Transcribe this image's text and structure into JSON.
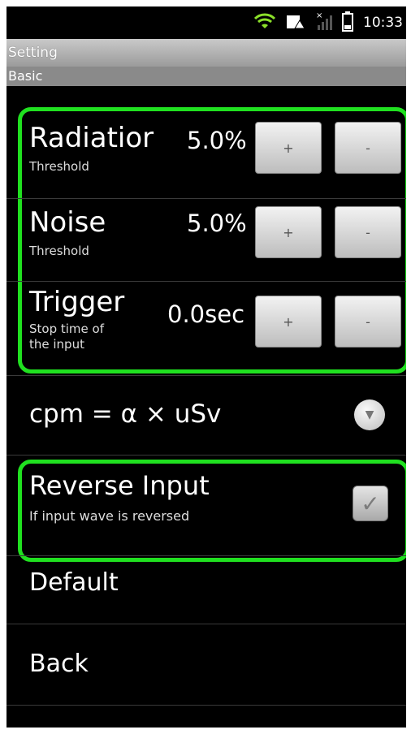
{
  "status": {
    "time": "10:33",
    "icons": [
      "wifi-icon",
      "sd-card-icon",
      "signal-icon",
      "battery-icon"
    ]
  },
  "titlebar": {
    "title": "Setting"
  },
  "section": {
    "label": "Basic"
  },
  "settings": [
    {
      "name": "Radiatior",
      "sub": "Threshold",
      "value": "5.0%",
      "plus": "+",
      "minus": "-"
    },
    {
      "name": "Noise",
      "sub": "Threshold",
      "value": "5.0%",
      "plus": "+",
      "minus": "-"
    },
    {
      "name": "Trigger",
      "sub": "Stop time of the input",
      "value": "0.0sec",
      "plus": "+",
      "minus": "-"
    }
  ],
  "formula": {
    "text": "cpm = α × uSv"
  },
  "reverse": {
    "title": "Reverse Input",
    "sub": "If input wave is reversed",
    "checked": true
  },
  "menu": {
    "default": "Default",
    "back": "Back"
  },
  "colors": {
    "highlight": "#20e020"
  }
}
